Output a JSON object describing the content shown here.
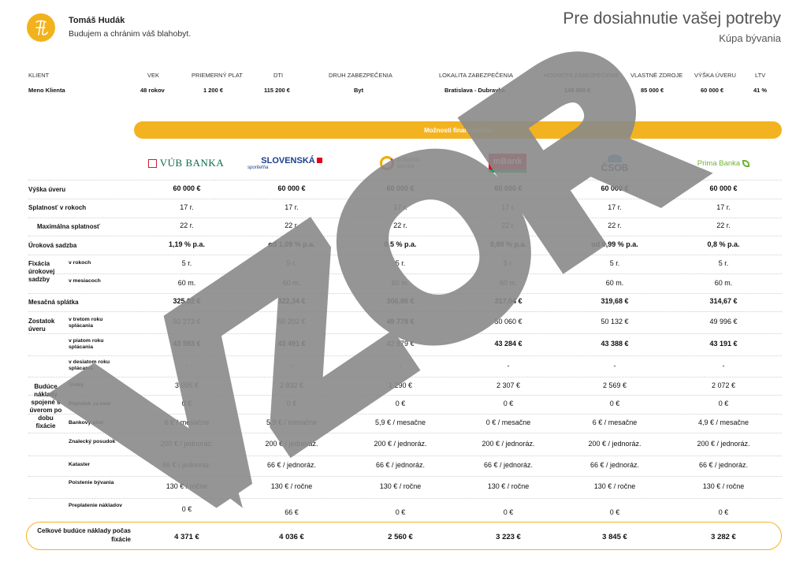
{
  "header": {
    "agent_name": "Tomáš Hudák",
    "agent_slogan": "Budujem a chránim váš blahobyt.",
    "title": "Pre dosiahnutie vašej potreby",
    "subtitle": "Kúpa bývania",
    "logo_monogram": "TH",
    "brand_color": "#f3b320"
  },
  "client": {
    "headers": [
      "KLIENT",
      "VEK",
      "PRIEMERNÝ PLAT",
      "DTI",
      "DRUH ZABEZPEČENIA",
      "LOKALITA ZABEZPEČENIA",
      "HODNOTA ZABEZPEČENIE",
      "VLASTNÉ ZDROJE",
      "VÝŠKA ÚVERU",
      "LTV"
    ],
    "values": [
      "Meno Klienta",
      "48 rokov",
      "1 200 €",
      "115 200 €",
      "Byt",
      "Bratislava - Dubravka",
      "145 000 €",
      "85 000 €",
      "60 000 €",
      "41 %"
    ]
  },
  "banner": "Možnosti financovania",
  "banks": [
    {
      "name": "VÚB BANKA"
    },
    {
      "name": "SLOVENSKÁ",
      "sub": "sporiteľňa"
    },
    {
      "name": "poštová",
      "sub": "banka"
    },
    {
      "name": "mBank"
    },
    {
      "name": "ČSOB"
    },
    {
      "name": "Prima Banka"
    }
  ],
  "labels": {
    "vyska": "Výška úveru",
    "splatnost": "Splatnosť v rokoch",
    "max_splatnost": "Maximálna splatnosť",
    "sadzba": "Úroková sadzba",
    "fixacia": "Fixácia úrokovej sadzby",
    "v_rokoch": "v rokoch",
    "v_mesiacoch": "v mesiacoch",
    "splatka": "Mesačná splátka",
    "zostatok": "Zostatok úveru",
    "tretom": "v tretom roku splácania",
    "piatom": "v piatom roku splácania",
    "desiatom": "v desiatom roku splácania",
    "naklady": "Budúce náklady spojené s úverom po dobu fixácie",
    "uroky": "Úroky",
    "poplatok": "Poplatok za úver",
    "ucet": "Bankový účet",
    "posudok": "Znalecký posudok",
    "kataster": "Kataster",
    "poistenie": "Poistenie bývania",
    "preplatenie": "Preplatenie nákladov",
    "total": "Celkové budúce náklady počas fixácie"
  },
  "rows": {
    "vyska": [
      "60 000 €",
      "60 000 €",
      "60 000 €",
      "60 000 €",
      "60 000 €",
      "60 000 €"
    ],
    "splatnost": [
      "17 r.",
      "17 r.",
      "17 r.",
      "17 r.",
      "17 r.",
      "17 r."
    ],
    "max_splatnost": [
      "22 r.",
      "22 r.",
      "22 r.",
      "22 r.",
      "22 r.",
      "22 r."
    ],
    "sadzba": [
      "1,19 % p.a.",
      "od 1,09 % p.a.",
      "0,5 % p.a.",
      "0,89 % p.a.",
      "od 0,99 % p.a.",
      "0,8 % p.a."
    ],
    "fix_roky": [
      "5 r.",
      "5 r.",
      "5 r.",
      "5 r.",
      "5 r.",
      "5 r."
    ],
    "fix_mesiace": [
      "60 m.",
      "60 m.",
      "60 m.",
      "60 m.",
      "60 m.",
      "60 m."
    ],
    "splatka": [
      "325,02 €",
      "322,34 €",
      "306,86 €",
      "317,04 €",
      "319,68 €",
      "314,67 €"
    ],
    "tretom": [
      "50 273 €",
      "50 202 €",
      "49 778 €",
      "50 060 €",
      "50 132 €",
      "49 996 €"
    ],
    "piatom": [
      "43 593 €",
      "43 491 €",
      "42 879 €",
      "43 284 €",
      "43 388 €",
      "43 191 €"
    ],
    "desiatom": [
      "-",
      "-",
      "-",
      "-",
      "-",
      "-"
    ],
    "uroky": [
      "3 095 €",
      "2 832 €",
      "1 290 €",
      "2 307 €",
      "2 569 €",
      "2 072 €"
    ],
    "poplatok": [
      "0 €",
      "0 €",
      "0 €",
      "0 €",
      "0 €",
      "0 €"
    ],
    "ucet": [
      "6 € / mesačne",
      "5,9 € / mesačne",
      "5,9 € / mesačne",
      "0 € / mesačne",
      "6 € / mesačne",
      "4,9 € / mesačne"
    ],
    "posudok": [
      "200 € / jednoráz.",
      "200 € / jednoráz.",
      "200 € / jednoráz.",
      "200 € / jednoráz.",
      "200 € / jednoráz.",
      "200 € / jednoráz."
    ],
    "kataster": [
      "66 € / jednoráz.",
      "66 € / jednoráz.",
      "66 € / jednoráz.",
      "66 € / jednoráz.",
      "66 € / jednoráz.",
      "66 € / jednoráz."
    ],
    "poistenie": [
      "130 € / ročne",
      "130 € / ročne",
      "130 € / ročne",
      "130 € / ročne",
      "130 € / ročne",
      "130 € / ročne"
    ],
    "preplatenie": [
      "0 €",
      "66 €",
      "0 €",
      "0 €",
      "0 €",
      "0 €"
    ],
    "total": [
      "4 371 €",
      "4 036 €",
      "2 560 €",
      "3 223 €",
      "3 845 €",
      "3 282 €"
    ]
  },
  "watermark": "VZOR",
  "watermark_color": "#8a8a8a"
}
